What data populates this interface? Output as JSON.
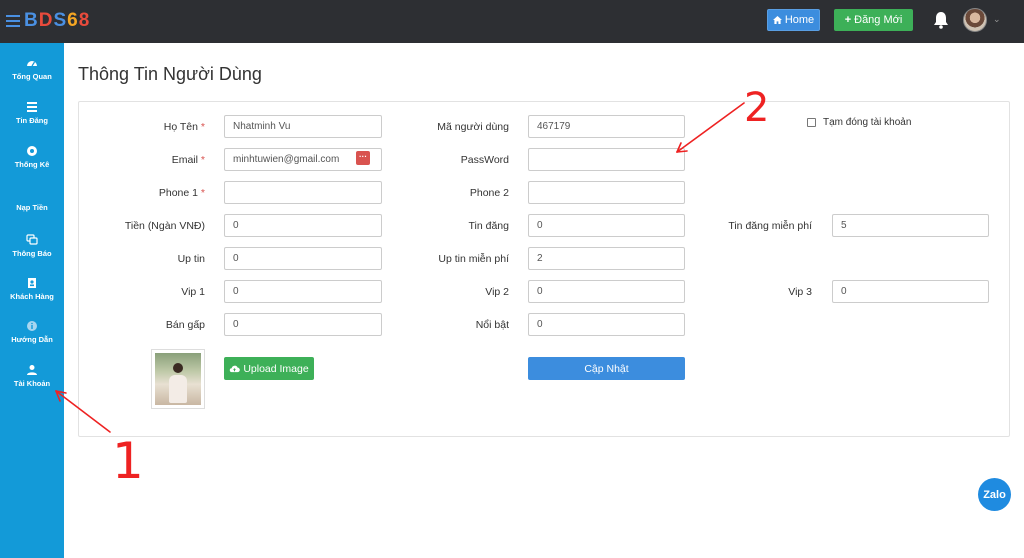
{
  "header": {
    "logo": [
      "B",
      "D",
      "S",
      "6",
      "8"
    ],
    "logo_colors": [
      "#4a90e2",
      "#e94b3c",
      "#4a90e2",
      "#f5a623",
      "#e94b3c"
    ],
    "home_label": "Home",
    "new_post_label": "Đăng Mới"
  },
  "sidebar": {
    "items": [
      {
        "label": "Tổng Quan",
        "icon": "dashboard-icon"
      },
      {
        "label": "Tin Đăng",
        "icon": "list-icon"
      },
      {
        "label": "Thống Kê",
        "icon": "chart-icon"
      },
      {
        "label": "Nạp Tiền",
        "icon": ""
      },
      {
        "label": "Thông Báo",
        "icon": "chat-icon"
      },
      {
        "label": "Khách Hàng",
        "icon": "contact-icon"
      },
      {
        "label": "Hướng Dẫn",
        "icon": "info-icon"
      },
      {
        "label": "Tài Khoản",
        "icon": "user-icon"
      }
    ]
  },
  "page": {
    "title": "Thông Tin Người Dùng"
  },
  "form": {
    "ho_ten": {
      "label": "Họ Tên",
      "value": "Nhatminh Vu"
    },
    "ma_nguoi_dung": {
      "label": "Mã người dùng",
      "value": "467179"
    },
    "tam_dong": {
      "label": "Tạm đóng tài khoản"
    },
    "email": {
      "label": "Email",
      "value": "minhtuwien@gmail.com"
    },
    "password": {
      "label": "PassWord",
      "value": ""
    },
    "phone1": {
      "label": "Phone 1",
      "value": ""
    },
    "phone2": {
      "label": "Phone 2",
      "value": ""
    },
    "tien": {
      "label": "Tiền (Ngàn VNĐ)",
      "value": "0"
    },
    "tin_dang": {
      "label": "Tin đăng",
      "value": "0"
    },
    "tin_dang_mien_phi": {
      "label": "Tin đăng miễn phí",
      "value": "5"
    },
    "up_tin": {
      "label": "Up tin",
      "value": "0"
    },
    "up_tin_mien_phi": {
      "label": "Up tin miễn phí",
      "value": "2"
    },
    "vip1": {
      "label": "Vip 1",
      "value": "0"
    },
    "vip2": {
      "label": "Vip 2",
      "value": "0"
    },
    "vip3": {
      "label": "Vip 3",
      "value": "0"
    },
    "ban_gap": {
      "label": "Bán gấp",
      "value": "0"
    },
    "noi_bat": {
      "label": "Nổi bật",
      "value": "0"
    },
    "upload_label": "Upload Image",
    "update_label": "Cập Nhật",
    "required_mark": "*"
  },
  "zalo": {
    "label": "Zalo"
  },
  "annotations": {
    "one": "1",
    "two": "2"
  }
}
